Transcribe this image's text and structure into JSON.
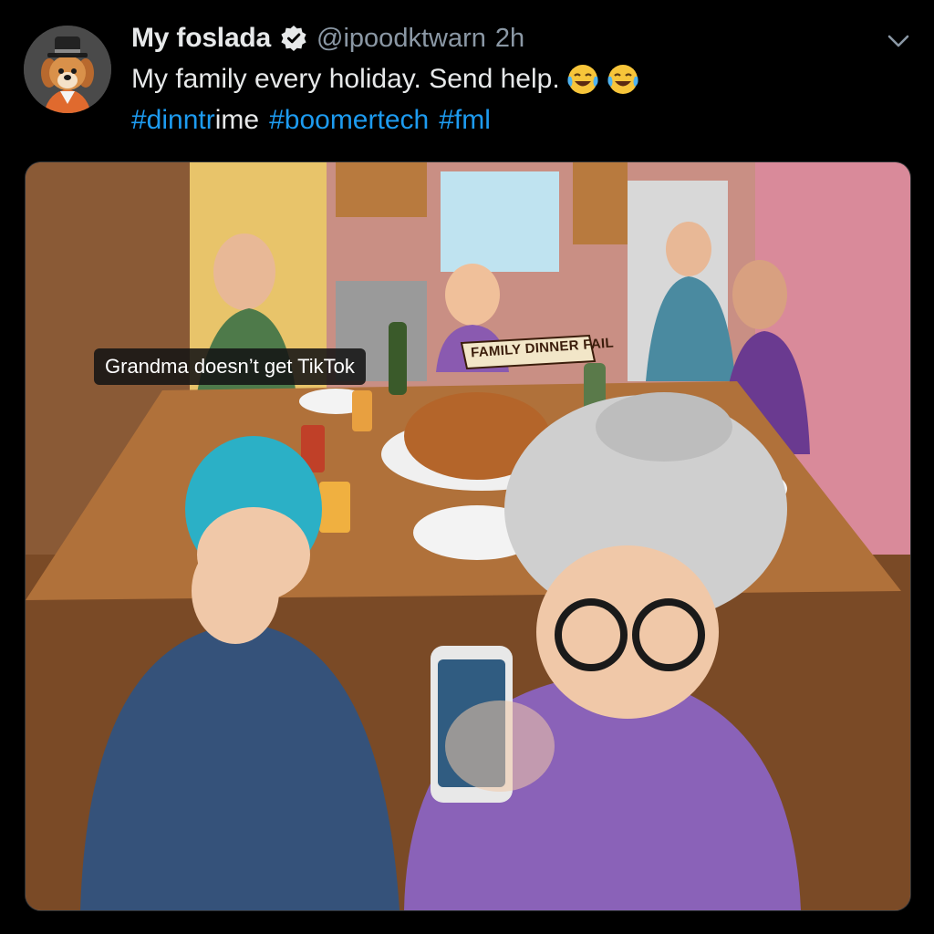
{
  "tweet": {
    "display_name": "My foslada",
    "handle": "@ipoodktwarn",
    "separator": "·",
    "time": "2h",
    "text": "My family every holiday. Send help.",
    "emojis": [
      "face-with-tears-of-joy",
      "face-with-tears-of-joy"
    ],
    "hashtags": {
      "first_blue": "#dinntr",
      "first_plain": "ime",
      "second": "#boomertech",
      "third": "#fml"
    }
  },
  "icons": {
    "verified": "verified-badge-icon",
    "more": "chevron-down-icon",
    "avatar": "dog-with-top-hat"
  },
  "media": {
    "caption": "Grandma doesn’t get TikTok",
    "sign": "FAMILY DINNER FAIL"
  },
  "colors": {
    "background": "#000000",
    "text": "#e7e9ea",
    "muted": "#8b98a5",
    "link": "#1d9bf0"
  }
}
